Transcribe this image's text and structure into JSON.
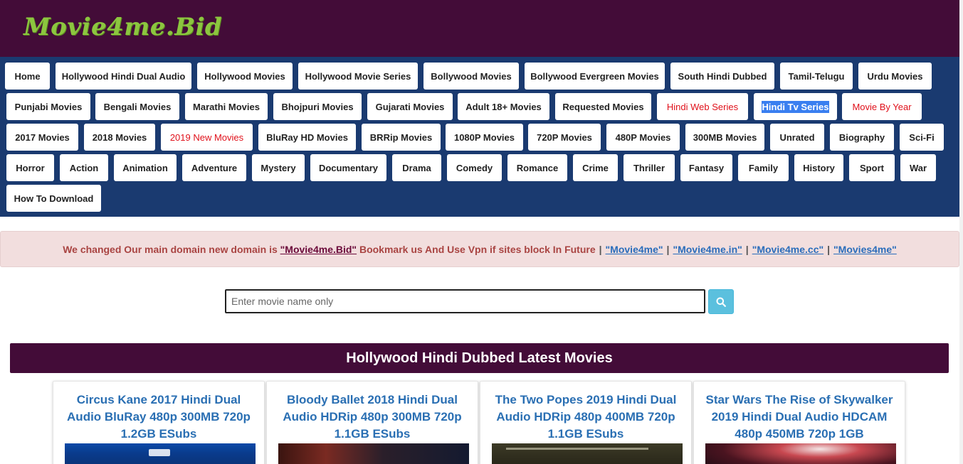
{
  "site": {
    "logo": "Movie4me.Bid"
  },
  "nav": {
    "rows": [
      [
        "Home",
        "Hollywood Hindi Dual Audio",
        "Hollywood Movies",
        "Hollywood Movie Series",
        "Bollywood Movies",
        "Bollywood Evergreen Movies",
        "South Hindi Dubbed",
        "Tamil-Telugu",
        "Urdu Movies"
      ],
      [
        "Punjabi Movies",
        "Bengali Movies",
        "Marathi Movies",
        "Bhojpuri Movies",
        "Gujarati Movies",
        "Adult 18+ Movies",
        "Requested Movies",
        "Hindi Web Series",
        "Hindi Tv Series",
        "Movie By Year"
      ],
      [
        "2017 Movies",
        "2018 Movies",
        "2019 New Movies",
        "BluRay HD Movies",
        "BRRip Movies",
        "1080P Movies",
        "720P Movies",
        "480P Movies",
        "300MB Movies",
        "Unrated",
        "Biography",
        "Sci-Fi"
      ],
      [
        "Horror",
        "Action",
        "Animation",
        "Adventure",
        "Mystery",
        "Documentary",
        "Drama",
        "Comedy",
        "Romance",
        "Crime",
        "Thriller",
        "Fantasy",
        "Family",
        "History",
        "Sport",
        "War"
      ],
      [
        "How To Download"
      ]
    ]
  },
  "notice": {
    "prefix": "We changed Our main domain new domain is",
    "new_domain": "\"Movie4me.Bid\"",
    "middle": "Bookmark us And Use Vpn if sites block In Future",
    "sep": "|",
    "alt_domains": [
      "\"Movie4me\"",
      "\"Movie4me.in\"",
      "\"Movie4me.cc\"",
      "\"Movies4me\""
    ]
  },
  "search": {
    "placeholder": "Enter movie name only",
    "icon": "search-icon"
  },
  "section": {
    "title": "Hollywood Hindi Dubbed Latest Movies"
  },
  "movies": [
    {
      "title": "Circus Kane 2017 Hindi Dual Audio BluRay 480p 300MB 720p 1.2GB ESubs"
    },
    {
      "title": "Bloody Ballet 2018 Hindi Dual Audio HDRip 480p 300MB 720p 1.1GB ESubs"
    },
    {
      "title": "The Two Popes 2019 Hindi Dual Audio HDRip 480p 400MB 720p 1.1GB ESubs"
    },
    {
      "title": "Star Wars The Rise of Skywalker 2019 Hindi Dual Audio HDCAM 480p 450MB 720p 1GB"
    }
  ],
  "colors": {
    "header_bg": "#430c38",
    "nav_bg": "#1a3a70",
    "logo": "#8cc63f",
    "link_blue": "#2a6fb3",
    "red_item": "#e0101a"
  }
}
